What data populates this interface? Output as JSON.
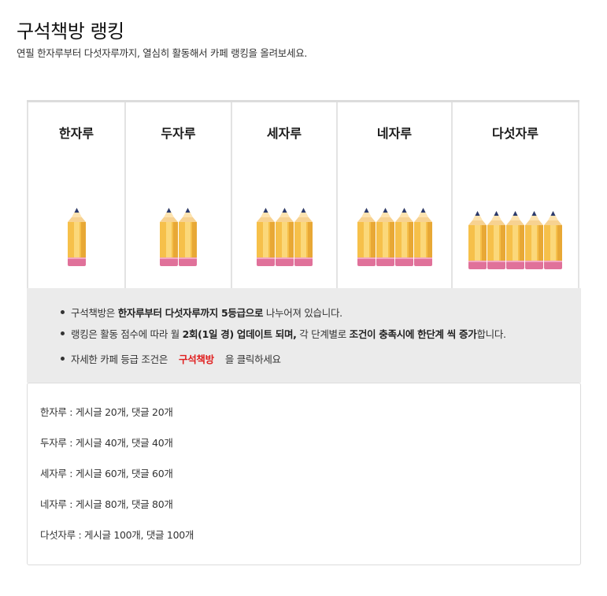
{
  "header": {
    "title": "구석책방 랭킹",
    "subtitle": "연필 한자루부터 다섯자루까지, 열심히 활동해서 카페 랭킹을 올려보세요."
  },
  "ranks": [
    {
      "label": "한자루",
      "pencils": 1,
      "icon": "pencil-icon"
    },
    {
      "label": "두자루",
      "pencils": 2,
      "icon": "pencil-icon"
    },
    {
      "label": "세자루",
      "pencils": 3,
      "icon": "pencil-icon"
    },
    {
      "label": "네자루",
      "pencils": 4,
      "icon": "pencil-icon"
    },
    {
      "label": "다섯자루",
      "pencils": 5,
      "icon": "pencil-icon"
    }
  ],
  "notice": {
    "line1": {
      "pre": "구석책방은 ",
      "bold": "한자루부터 다섯자루까지 5등급으로",
      "post": " 나누어져 있습니다."
    },
    "line2": {
      "pre": "랭킹은 활동 점수에 따라 월 ",
      "bold1": "2회(1일 경) 업데이트 되며,",
      "mid": " 각 단계별로 ",
      "bold2": "조건이 충족시에 한단계 씩 증가",
      "post": "합니다."
    },
    "line3": {
      "pre": "자세한 카페 등급 조건은",
      "link": "구석책방",
      "post": "을 클릭하세요"
    }
  },
  "conditions": [
    "한자루 : 게시글 20개, 댓글 20개",
    "두자루 : 게시글 40개, 댓글 40개",
    "세자루 : 게시글 60개, 댓글 60개",
    "네자루 : 게시글 80개, 댓글 80개",
    "다섯자루 : 게시글 100개, 댓글 100개"
  ],
  "colors": {
    "pencil_body": "#f6c04a",
    "pencil_stripe": "#fbd87a",
    "pencil_shade": "#e8a835",
    "pencil_tip": "#2a3a6e",
    "eraser": "#e0719a",
    "link": "#e02020",
    "notice_bg": "#ebebeb"
  }
}
